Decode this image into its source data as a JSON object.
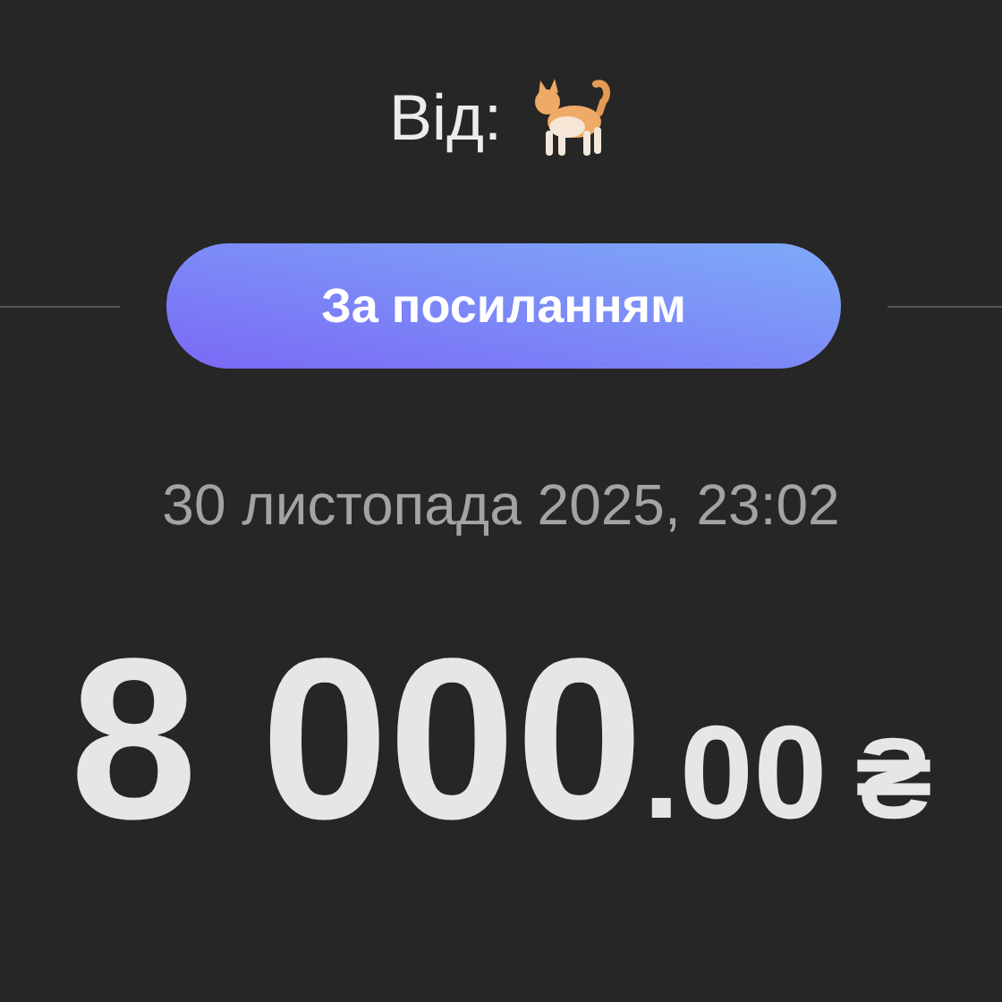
{
  "sender": {
    "label": "Від:"
  },
  "source_badge": {
    "label": "За посиланням"
  },
  "date": "30 листопада 2025, 23:02",
  "amount": {
    "integer": "8 000",
    "fraction": ".00",
    "currency": "₴"
  }
}
